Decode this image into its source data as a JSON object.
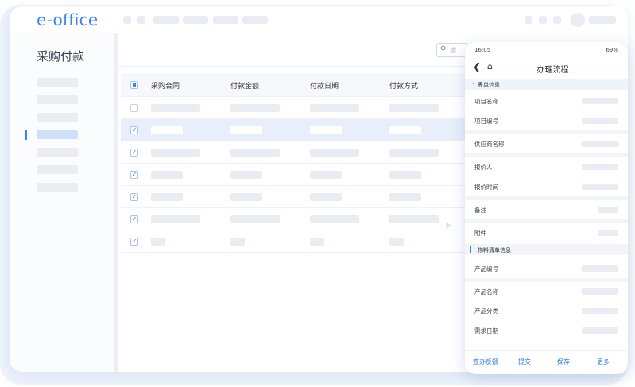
{
  "app": {
    "logo": "e-office"
  },
  "sidebar": {
    "title": "采购付款",
    "item_count": 7,
    "active_index": 3
  },
  "toolbar": {
    "search_placeholder": "搜"
  },
  "table": {
    "headers": [
      "采购合同",
      "付款金额",
      "付款日期",
      "付款方式"
    ],
    "rows": [
      {
        "checked": false,
        "selected": false
      },
      {
        "checked": true,
        "selected": true
      },
      {
        "checked": true,
        "selected": false
      },
      {
        "checked": true,
        "selected": false
      },
      {
        "checked": true,
        "selected": false
      },
      {
        "checked": true,
        "selected": false
      },
      {
        "checked": true,
        "selected": false
      }
    ]
  },
  "phone": {
    "status": {
      "time": "16:05",
      "battery": "69%"
    },
    "nav_title": "办理流程",
    "section_form": "表单信息",
    "form_fields": [
      "项目名称",
      "项目编号",
      "供应商名称",
      "报价人",
      "报价时间",
      "备注",
      "附件"
    ],
    "section_material": "物料清单信息",
    "material_fields": [
      "产品编号",
      "产品名称",
      "产品分类",
      "需求日期"
    ],
    "footer": {
      "feedback": "签办反馈",
      "submit": "提交",
      "save": "保存",
      "more": "更多"
    }
  },
  "colors": {
    "accent": "#3b82f6",
    "selected_row": "#e8effb",
    "placeholder": "#e9edf3"
  }
}
